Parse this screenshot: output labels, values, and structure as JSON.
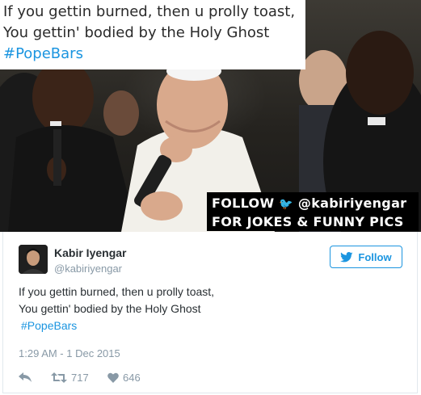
{
  "meme": {
    "caption_line1": "If you gettin burned, then u prolly toast,",
    "caption_line2": "You gettin' bodied by the Holy Ghost",
    "caption_hashtag": "#PopeBars",
    "banner_line1_prefix": "FOLLOW",
    "banner_handle": "@kabiriyengar",
    "banner_line2": "FOR JOKES & FUNNY PICS"
  },
  "tweet": {
    "author_name": "Kabir Iyengar",
    "author_handle": "@kabiriyengar",
    "follow_label": "Follow",
    "text_line1": "If you gettin burned, then u prolly toast,",
    "text_line2": "You gettin' bodied by the Holy Ghost",
    "hashtag": "#PopeBars",
    "timestamp": "1:29 AM - 1 Dec 2015",
    "retweet_count": "717",
    "like_count": "646"
  },
  "icons": {
    "reply": "reply-icon",
    "retweet": "retweet-icon",
    "like": "heart-icon",
    "follow": "twitter-bird-icon"
  },
  "colors": {
    "accent": "#1b95e0",
    "muted": "#8899a6",
    "text": "#292f33"
  }
}
